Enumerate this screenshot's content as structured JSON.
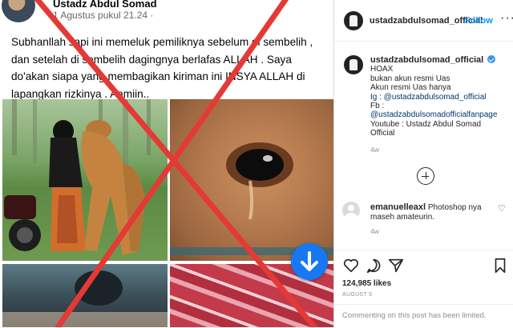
{
  "facebook_post": {
    "author": "Ustadz Abdul Somad",
    "date": "1 Agustus pukul 21.24 ·",
    "text": "Subhanllah sapi ini memeluk pemiliknya sebelum di sembelih , dan setelah di sembelih dagingnya berlafas ALLAH . Saya do'akan siapa yang membagikan kiriman ini INSYA ALLAH di lapangkan rizkinya . Aamiin..",
    "hoax_mark_color": "#e53935",
    "fab_icon": "arrow-down-icon"
  },
  "instagram": {
    "header": {
      "username": "ustadzabdulsomad_official",
      "follow_label": "Follow",
      "more_icon": "more-options-icon"
    },
    "caption": {
      "username": "ustadzabdulsomad_official",
      "lines": [
        "HOAX",
        "bukan akun resmi Uas",
        "Akun resmi Uas hanya",
        "Ig : @ustadzabdulsomad_official",
        "Fb :",
        "@ustadzabdulsomadofficialfanpage",
        "Youtube : Ustadz Abdul Somad",
        "Official"
      ],
      "time": "4w"
    },
    "load_more_icon": "plus-circle-icon",
    "comment": {
      "username": "emanuelleaxl",
      "text": "Photoshop nya maseh amateurin.",
      "time": "4w"
    },
    "actions": {
      "likes": "124,985 likes",
      "date": "AUGUST 5",
      "limited_notice": "Commenting on this post has been limited."
    }
  }
}
